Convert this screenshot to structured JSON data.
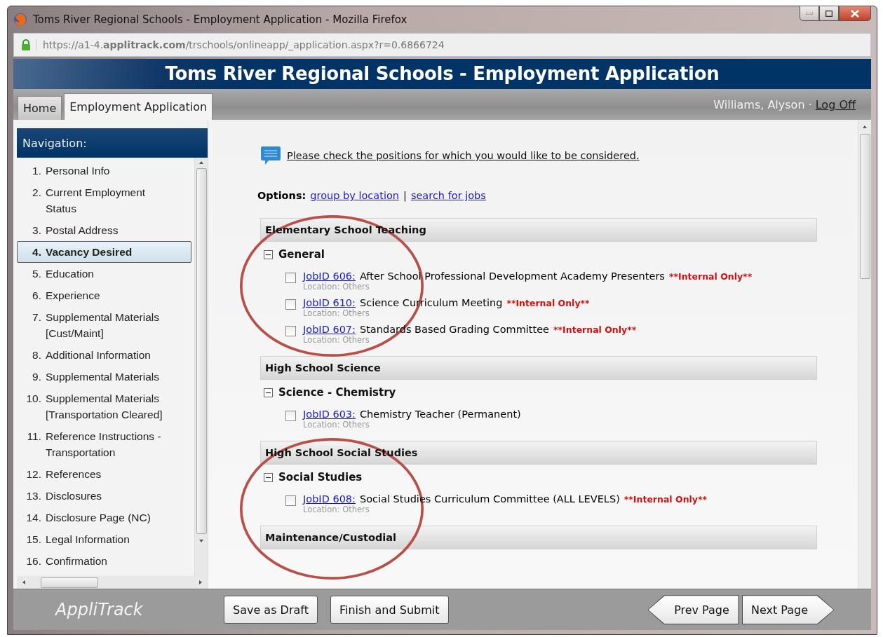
{
  "window": {
    "title": "Toms River Regional Schools - Employment Application - Mozilla Firefox"
  },
  "address_bar": {
    "url": "https://a1-4.**applitrack.com**/trschools/onlineapp/_application.aspx?r=0.6866724"
  },
  "banner": {
    "title": "Toms River Regional Schools - Employment Application"
  },
  "tabs": [
    {
      "label": "Home",
      "selected": false
    },
    {
      "label": "Employment Application",
      "selected": true
    }
  ],
  "user": {
    "name": "Williams, Alyson ·",
    "logoff": "Log Off"
  },
  "navigation": {
    "title": "Navigation:",
    "items": [
      {
        "number": "1.",
        "label": "Personal Info",
        "selected": false
      },
      {
        "number": "2.",
        "label": "Current Employment Status",
        "selected": false
      },
      {
        "number": "3.",
        "label": "Postal Address",
        "selected": false
      },
      {
        "number": "4.",
        "label": "Vacancy Desired",
        "selected": true
      },
      {
        "number": "5.",
        "label": "Education",
        "selected": false
      },
      {
        "number": "6.",
        "label": "Experience",
        "selected": false
      },
      {
        "number": "7.",
        "label": "Supplemental Materials [Cust/Maint]",
        "selected": false
      },
      {
        "number": "8.",
        "label": "Additional Information",
        "selected": false
      },
      {
        "number": "9.",
        "label": "Supplemental Materials",
        "selected": false
      },
      {
        "number": "10.",
        "label": "Supplemental Materials [Transportation Cleared]",
        "selected": false
      },
      {
        "number": "11.",
        "label": "Reference Instructions - Transportation",
        "selected": false
      },
      {
        "number": "12.",
        "label": "References",
        "selected": false
      },
      {
        "number": "13.",
        "label": "Disclosures",
        "selected": false
      },
      {
        "number": "14.",
        "label": "Disclosure Page (NC)",
        "selected": false
      },
      {
        "number": "15.",
        "label": "Legal Information",
        "selected": false
      },
      {
        "number": "16.",
        "label": "Confirmation",
        "selected": false
      }
    ]
  },
  "content": {
    "instruction": "Please check the positions for which you would like to be considered.",
    "options_label": "Options:",
    "options": [
      "group by location",
      "search for jobs"
    ],
    "separator": "|",
    "categories": [
      {
        "title": "Elementary School Teaching",
        "groups": [
          {
            "title": "General",
            "expanded": true,
            "circled": true,
            "jobs": [
              {
                "id": "JobID 606:",
                "title": "After School Professional Development Academy Presenters",
                "note": "**Internal Only**",
                "location": "Location: Others",
                "checked": false
              },
              {
                "id": "JobID 610:",
                "title": "Science Curriculum Meeting",
                "note": "**Internal Only**",
                "location": "Location: Others",
                "checked": false
              },
              {
                "id": "JobID 607:",
                "title": "Standards Based Grading Committee",
                "note": "**Internal Only**",
                "location": "Location: Others",
                "checked": false
              }
            ]
          }
        ]
      },
      {
        "title": "High School Science",
        "groups": [
          {
            "title": "Science - Chemistry",
            "expanded": true,
            "jobs": [
              {
                "id": "JobID 603:",
                "title": "Chemistry Teacher (Permanent)",
                "location": "Location: Others",
                "checked": false
              }
            ]
          }
        ]
      },
      {
        "title": "High School Social Studies",
        "groups": [
          {
            "title": "Social Studies",
            "expanded": true,
            "circled": true,
            "jobs": [
              {
                "id": "JobID 608:",
                "title": "Social Studies Curriculum Committee (ALL LEVELS)",
                "note": "**Internal Only**",
                "location": "Location: Others",
                "checked": false
              }
            ]
          }
        ]
      },
      {
        "title": "Maintenance/Custodial"
      }
    ]
  },
  "footer": {
    "logo": "AppliTrack",
    "buttons": [
      "Save as Draft",
      "Finish and Submit"
    ],
    "prev": "Prev Page",
    "next": "Next Page"
  }
}
